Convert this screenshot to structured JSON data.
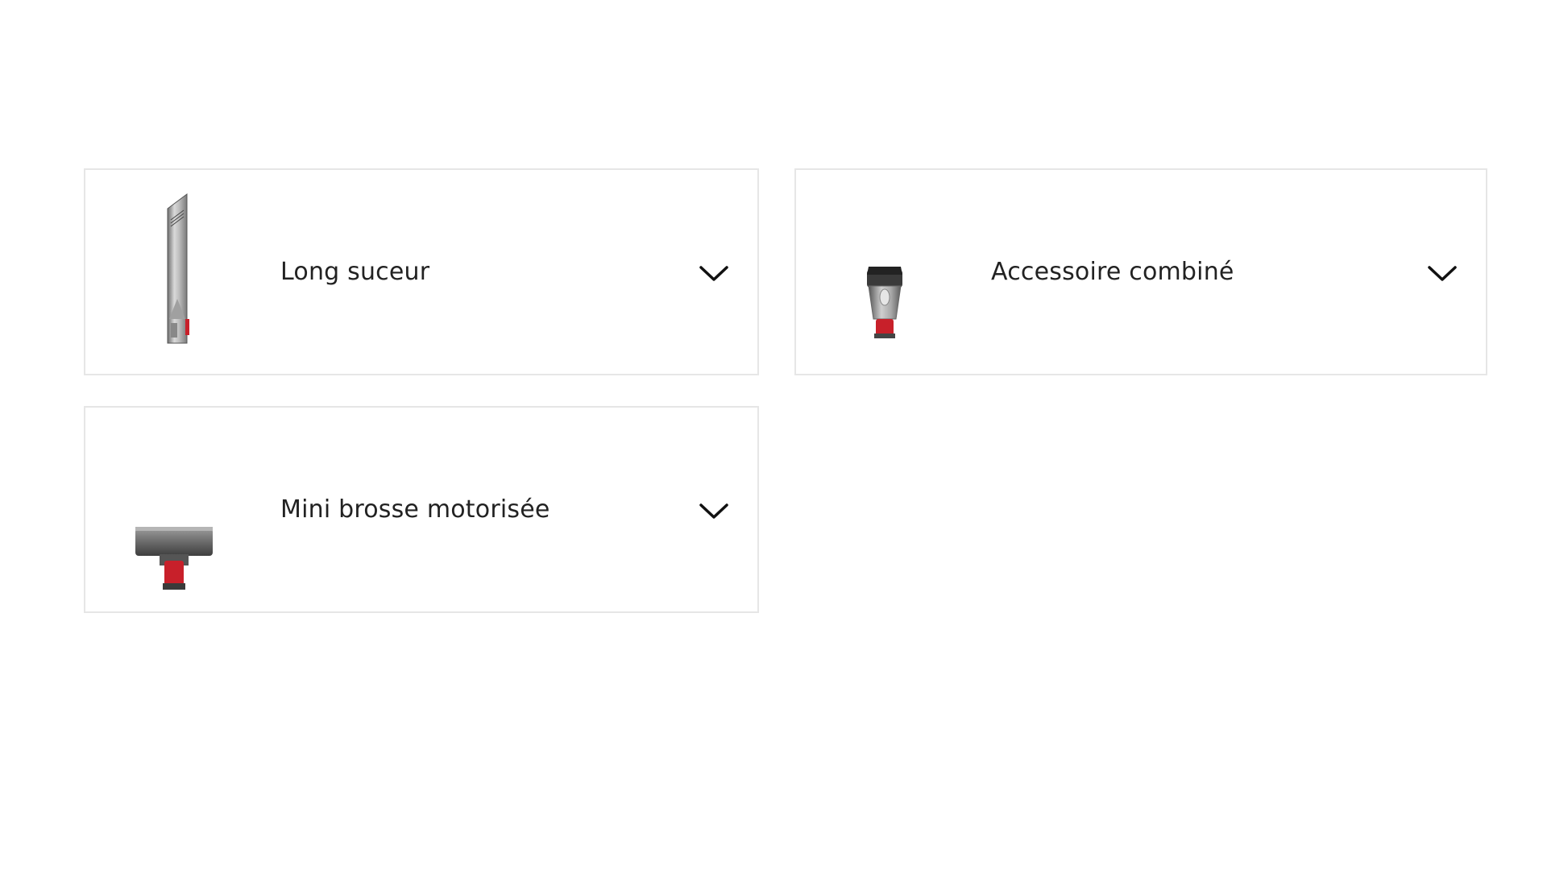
{
  "accessories": [
    {
      "label": "Long suceur",
      "icon": "crevice-tool-icon",
      "expanded": false
    },
    {
      "label": "Accessoire combiné",
      "icon": "combination-tool-icon",
      "expanded": false
    },
    {
      "label": "Mini brosse motorisée",
      "icon": "mini-motorized-brush-icon",
      "expanded": false
    }
  ],
  "colors": {
    "border": "#e6e6e6",
    "text": "#222222",
    "accent_red": "#c8202a",
    "metal": "#9a9a9a"
  },
  "chevron_icon": "chevron-down-icon"
}
